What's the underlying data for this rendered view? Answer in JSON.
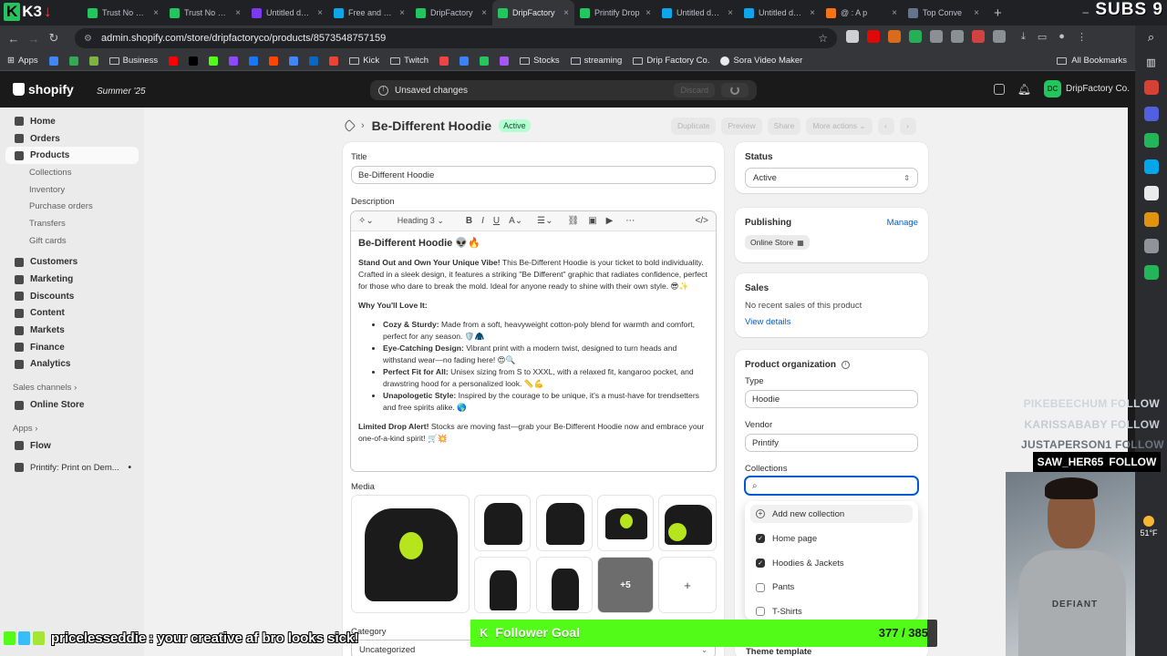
{
  "browser": {
    "tabs": [
      {
        "title": "",
        "color": "#22c55e",
        "active": false
      },
      {
        "title": "Trust No One",
        "color": "#22c55e",
        "active": false
      },
      {
        "title": "Trust No One",
        "color": "#22c55e",
        "active": false
      },
      {
        "title": "Untitled design",
        "color": "#7c3aed",
        "active": false
      },
      {
        "title": "Free and custom",
        "color": "#0ea5e9",
        "active": false
      },
      {
        "title": "DripFactory",
        "color": "#22c55e",
        "active": false
      },
      {
        "title": "DripFactory",
        "color": "#22c55e",
        "active": true
      },
      {
        "title": "Printify Drop",
        "color": "#22c55e",
        "active": false
      },
      {
        "title": "Untitled design",
        "color": "#0ea5e9",
        "active": false
      },
      {
        "title": "Untitled design",
        "color": "#0ea5e9",
        "active": false
      },
      {
        "title": "@ : A p",
        "color": "#f97316",
        "active": false
      },
      {
        "title": "Top Conve",
        "color": "#64748b",
        "active": false
      }
    ],
    "url": "admin.shopify.com/store/dripfactoryco/products/8573548757159",
    "bookmarks": [
      {
        "label": "Apps",
        "type": "apps"
      },
      {
        "label": "",
        "type": "icon",
        "color": "#4285f4"
      },
      {
        "label": "",
        "type": "icon",
        "color": "#34a853"
      },
      {
        "label": "",
        "type": "icon",
        "color": "#7cb342"
      },
      {
        "label": "Business",
        "type": "folder"
      },
      {
        "label": "",
        "type": "icon",
        "color": "#ff0000"
      },
      {
        "label": "",
        "type": "icon",
        "color": "#000000"
      },
      {
        "label": "",
        "type": "icon",
        "color": "#53fc18"
      },
      {
        "label": "",
        "type": "icon",
        "color": "#9146ff"
      },
      {
        "label": "",
        "type": "icon",
        "color": "#1877f2"
      },
      {
        "label": "",
        "type": "icon",
        "color": "#ff4500"
      },
      {
        "label": "",
        "type": "icon",
        "color": "#4285f4"
      },
      {
        "label": "",
        "type": "icon",
        "color": "#0a66c2"
      },
      {
        "label": "",
        "type": "icon",
        "color": "#ea4335"
      },
      {
        "label": "Kick",
        "type": "folder"
      },
      {
        "label": "Twitch",
        "type": "folder"
      },
      {
        "label": "",
        "type": "icon",
        "color": "#ef4444"
      },
      {
        "label": "",
        "type": "icon",
        "color": "#3b82f6"
      },
      {
        "label": "",
        "type": "icon",
        "color": "#22c55e"
      },
      {
        "label": "",
        "type": "icon",
        "color": "#a855f7"
      },
      {
        "label": "Stocks",
        "type": "folder"
      },
      {
        "label": "streaming",
        "type": "folder"
      },
      {
        "label": "Drip Factory Co.",
        "type": "folder"
      },
      {
        "label": "Sora Video Maker",
        "type": "site"
      }
    ],
    "all_bookmarks": "All Bookmarks",
    "overlay_top_left": "K3",
    "overlay_top_right": "SUBS 9"
  },
  "shopify": {
    "brand": "shopify",
    "edition": "Summer '25",
    "unsaved": "Unsaved changes",
    "discard": "Discard",
    "store_name": "DripFactory Co.",
    "store_initials": "DC"
  },
  "sidebar": {
    "items": [
      {
        "label": "Home",
        "kind": "main",
        "name": "home"
      },
      {
        "label": "Orders",
        "kind": "main",
        "name": "orders"
      },
      {
        "label": "Products",
        "kind": "main",
        "name": "products",
        "active": true
      },
      {
        "label": "Collections",
        "kind": "sub",
        "name": "collections"
      },
      {
        "label": "Inventory",
        "kind": "sub",
        "name": "inventory"
      },
      {
        "label": "Purchase orders",
        "kind": "sub",
        "name": "purchase-orders"
      },
      {
        "label": "Transfers",
        "kind": "sub",
        "name": "transfers"
      },
      {
        "label": "Gift cards",
        "kind": "sub",
        "name": "gift-cards"
      },
      {
        "label": "",
        "kind": "gap",
        "name": "gap"
      },
      {
        "label": "Customers",
        "kind": "main",
        "name": "customers"
      },
      {
        "label": "Marketing",
        "kind": "main",
        "name": "marketing"
      },
      {
        "label": "Discounts",
        "kind": "main",
        "name": "discounts"
      },
      {
        "label": "Content",
        "kind": "main",
        "name": "content"
      },
      {
        "label": "Markets",
        "kind": "main",
        "name": "markets"
      },
      {
        "label": "Finance",
        "kind": "main",
        "name": "finance"
      },
      {
        "label": "Analytics",
        "kind": "main",
        "name": "analytics"
      },
      {
        "label": "Sales channels  ›",
        "kind": "section",
        "name": "sales-channels"
      },
      {
        "label": "Online Store",
        "kind": "main",
        "name": "online-store"
      },
      {
        "label": "Apps  ›",
        "kind": "section",
        "name": "apps"
      },
      {
        "label": "Flow",
        "kind": "main",
        "name": "flow"
      },
      {
        "label": "",
        "kind": "gap",
        "name": "gap"
      },
      {
        "label": "Printify: Print on Dem...",
        "kind": "app",
        "name": "printify"
      }
    ]
  },
  "page": {
    "title": "Be-Different Hoodie",
    "status_badge": "Active",
    "actions": [
      "Duplicate",
      "Preview",
      "Share",
      "More actions ⌄"
    ],
    "title_label": "Title",
    "title_value": "Be-Different Hoodie",
    "description_label": "Description",
    "rte_toolbar": {
      "heading": "Heading 3"
    },
    "description": {
      "heading": "Be-Different Hoodie 👽🔥",
      "intro_bold": "Stand Out and Own Your Unique Vibe!",
      "intro": " This Be-Different Hoodie is your ticket to bold individuality. Crafted in a sleek design, it features a striking \"Be Different\" graphic that radiates confidence, perfect for those who dare to break the mold. Ideal for anyone ready to shine with their own style. 😎✨",
      "why": "Why You'll Love It:",
      "bullets": [
        {
          "bold": "Cozy & Sturdy:",
          "text": " Made from a soft, heavyweight cotton-poly blend for warmth and comfort, perfect for any season. 🛡️🧥"
        },
        {
          "bold": "Eye-Catching Design:",
          "text": " Vibrant print with a modern twist, designed to turn heads and withstand wear—no fading here! 😍🔍"
        },
        {
          "bold": "Perfect Fit for All:",
          "text": " Unisex sizing from S to XXXL, with a relaxed fit, kangaroo pocket, and drawstring hood for a personalized look. 📏💪"
        },
        {
          "bold": "Unapologetic Style:",
          "text": " Inspired by the courage to be unique, it's a must-have for trendsetters and free spirits alike. 🌎"
        }
      ],
      "closing_bold": "Limited Drop Alert!",
      "closing": " Stocks are moving fast—grab your Be-Different Hoodie now and embrace your one-of-a-kind spirit! 🛒💥"
    },
    "media_label": "Media",
    "media_more": "+5",
    "media_add": "+",
    "category_label": "Category",
    "category_value": "Uncategorized"
  },
  "right": {
    "status_label": "Status",
    "status_value": "Active",
    "publishing_label": "Publishing",
    "manage": "Manage",
    "channel_chip": "Online Store",
    "sales_label": "Sales",
    "sales_empty": "No recent sales of this product",
    "view_details": "View details",
    "org_label": "Product organization",
    "type_label": "Type",
    "type_value": "Hoodie",
    "vendor_label": "Vendor",
    "vendor_value": "Printify",
    "collections_label": "Collections",
    "add_collection": "Add new collection",
    "collections": [
      {
        "label": "Home page",
        "checked": true
      },
      {
        "label": "Hoodies & Jackets",
        "checked": true
      },
      {
        "label": "Pants",
        "checked": false
      },
      {
        "label": "T-Shirts",
        "checked": false
      }
    ],
    "theme_template": "Theme template"
  },
  "stream": {
    "follows": [
      {
        "name": "PIKEBEECHUM",
        "action": "FOLLOW",
        "color": "#d1d5db"
      },
      {
        "name": "KARISSABABY",
        "action": "FOLLOW",
        "color": "#c7cbd1"
      },
      {
        "name": "JUSTAPERSON1",
        "action": "FOLLOW",
        "color": "#6b7280"
      }
    ],
    "latest_follow": {
      "name": "SAW_HER65",
      "action": "FOLLOW"
    },
    "shirt_text": "DEFIANT",
    "weather_temp": "51°F",
    "goal_label": "Follower Goal",
    "goal_count": "377 / 385",
    "goal_current": 377,
    "goal_target": 385,
    "goal_color": "#53fc18",
    "chat_user": "pricelesseddie",
    "chat_message": ": your creative af bro looks sick!"
  },
  "rail_icons": [
    "#ea4335",
    "#5865f2",
    "#22c55e",
    "#00b2ff",
    "#ffffff",
    "#f59e0b",
    "#9aa0a6",
    "#22c55e"
  ]
}
